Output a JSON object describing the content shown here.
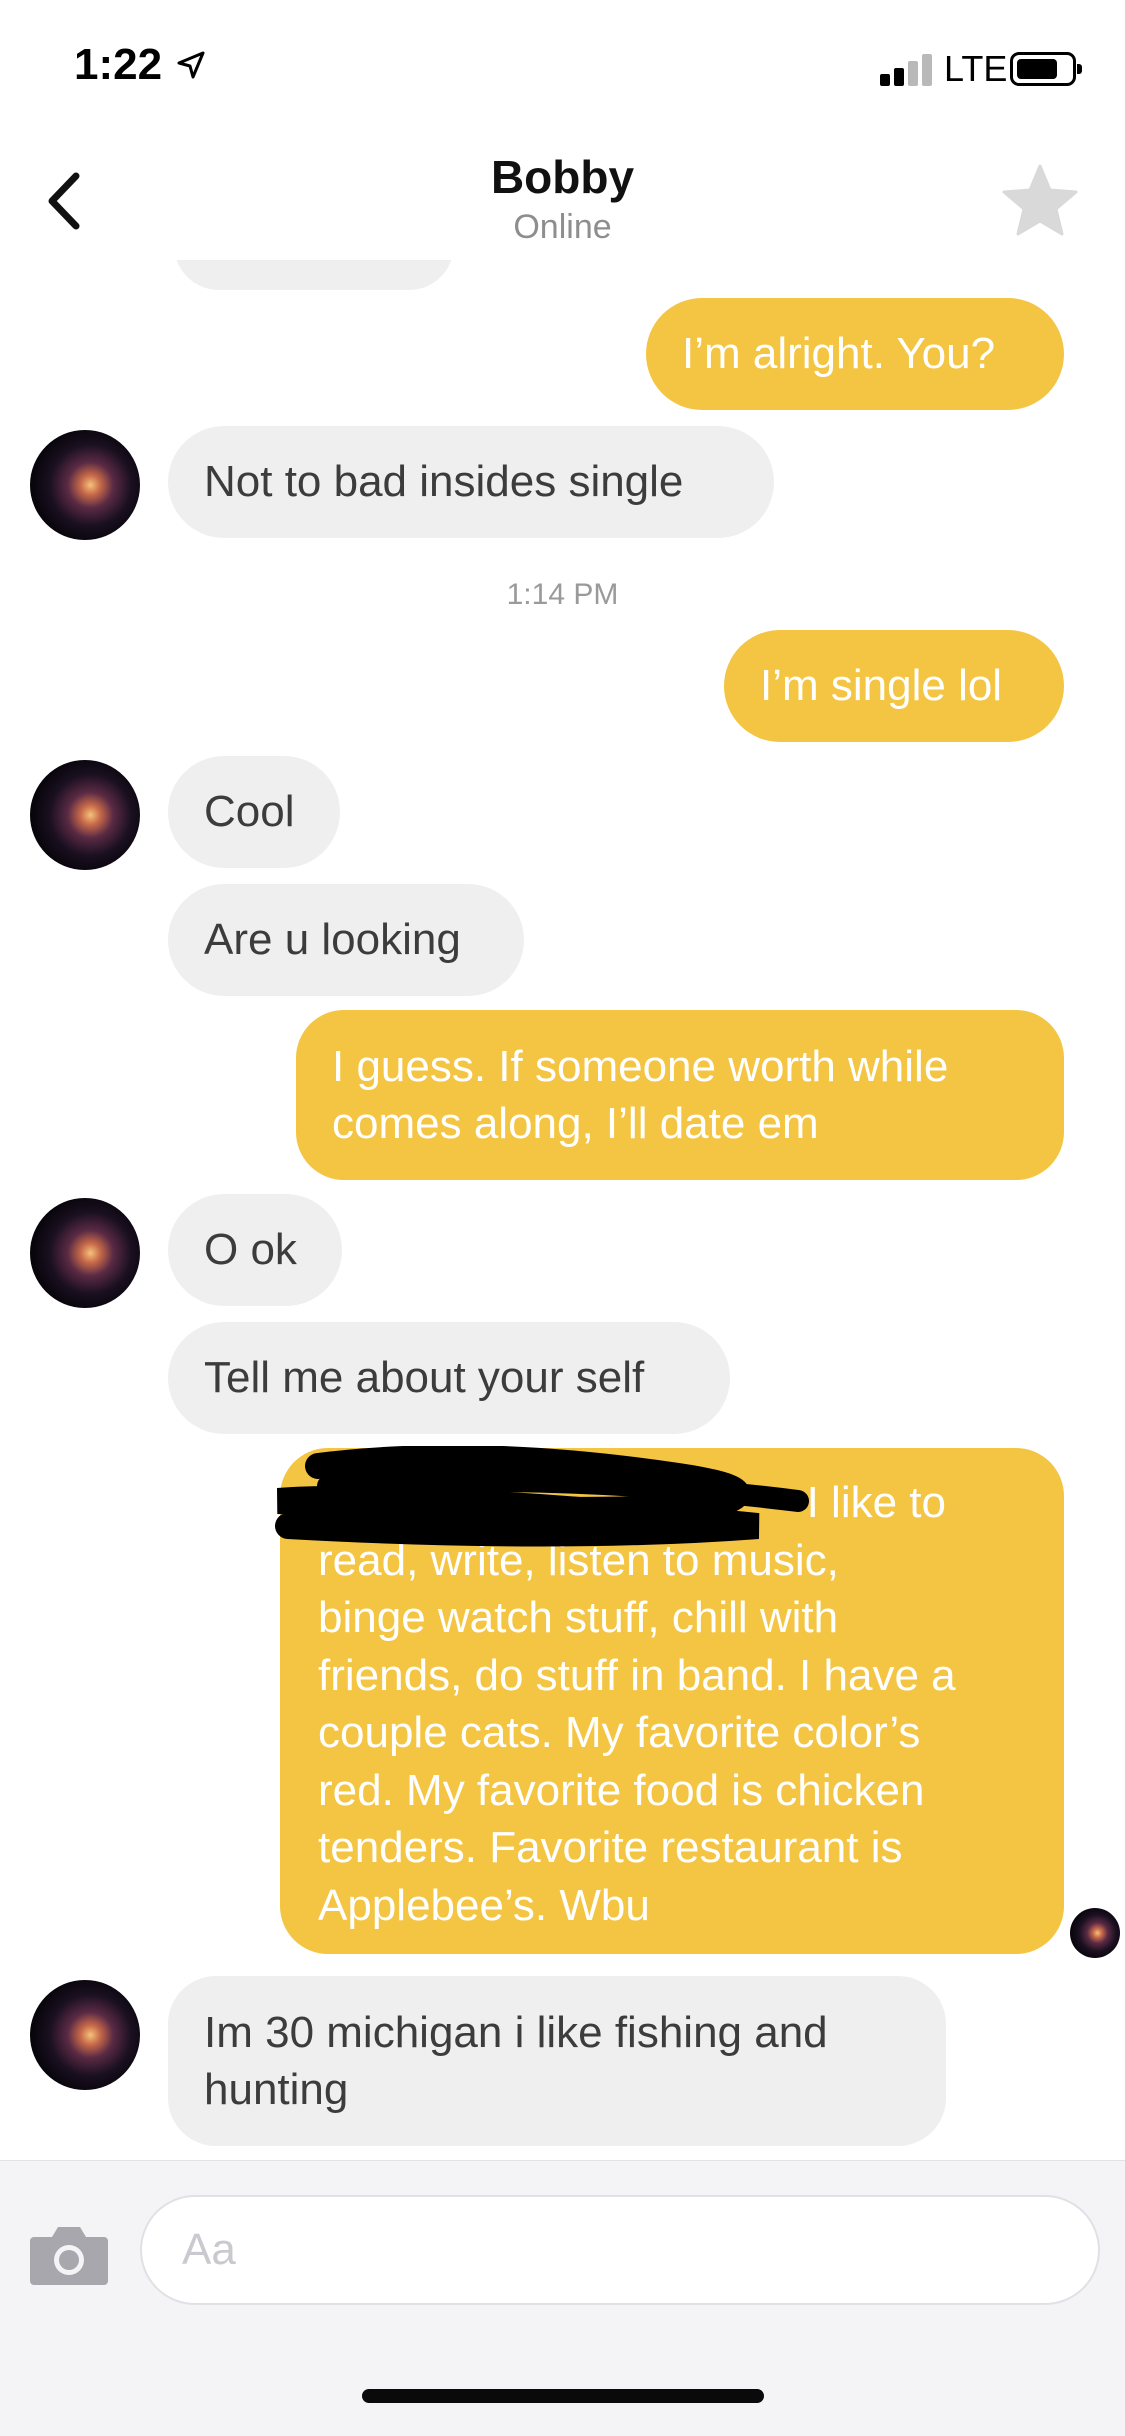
{
  "status_bar": {
    "time": "1:22",
    "network": "LTE"
  },
  "header": {
    "contact_name": "Bobby",
    "contact_status": "Online"
  },
  "messages": [
    {
      "from": "me",
      "text": "I’m alright. You?"
    },
    {
      "from": "them",
      "text": "Not to bad insides single"
    },
    {
      "from": "timestamp",
      "text": "1:14 PM"
    },
    {
      "from": "me",
      "text": "I’m single lol"
    },
    {
      "from": "them",
      "text": "Cool"
    },
    {
      "from": "them",
      "text": "Are u looking"
    },
    {
      "from": "me",
      "lines": [
        "I guess. If someone worth while",
        "comes along, I’ll date em"
      ]
    },
    {
      "from": "them",
      "text": "O ok"
    },
    {
      "from": "them",
      "text": "Tell me about your self"
    },
    {
      "from": "me",
      "lines": [
        "I like to",
        "read, write, listen to music,",
        "binge watch stuff, chill with",
        "friends, do stuff in band. I have a",
        "couple cats. My favorite color’s",
        "red. My favorite food is chicken",
        "tenders. Favorite restaurant is",
        "Applebee’s. Wbu"
      ]
    },
    {
      "from": "them",
      "lines": [
        "Im 30 michigan i like fishing and",
        "hunting"
      ]
    }
  ],
  "composer": {
    "placeholder": "Aa"
  },
  "colors": {
    "outgoing_bubble": "#f4c543",
    "incoming_bubble": "#efefef",
    "star": "#d9d9d9"
  }
}
